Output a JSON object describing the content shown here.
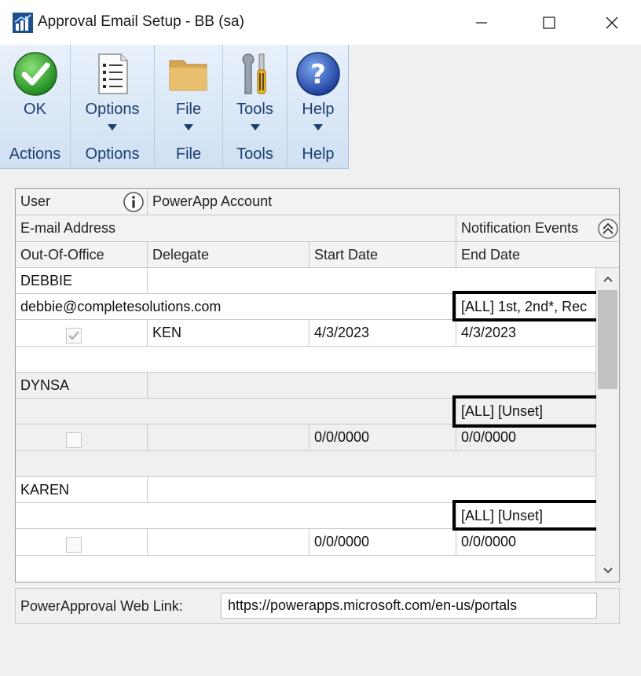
{
  "window": {
    "title": "Approval Email Setup  -  BB (sa)",
    "minimize_icon": "minimize-icon",
    "maximize_icon": "maximize-icon",
    "close_icon": "close-icon"
  },
  "ribbon": {
    "groups": [
      {
        "button_label": "OK",
        "group_label": "Actions",
        "icon": "green-check-icon",
        "has_dropdown": false
      },
      {
        "button_label": "Options",
        "group_label": "Options",
        "icon": "document-list-icon",
        "has_dropdown": true
      },
      {
        "button_label": "File",
        "group_label": "File",
        "icon": "folder-icon",
        "has_dropdown": true
      },
      {
        "button_label": "Tools",
        "group_label": "Tools",
        "icon": "wrench-screwdriver-icon",
        "has_dropdown": true
      },
      {
        "button_label": "Help",
        "group_label": "Help",
        "icon": "help-icon",
        "has_dropdown": true
      }
    ]
  },
  "grid": {
    "headers": {
      "user": "User",
      "powerapp_account": "PowerApp Account",
      "email_address": "E-mail Address",
      "notification_events": "Notification Events",
      "out_of_office": "Out-Of-Office",
      "delegate": "Delegate",
      "start_date": "Start Date",
      "end_date": "End Date"
    },
    "records": [
      {
        "user": "DEBBIE",
        "powerapp_account": "",
        "email": "debbie@completesolutions.com",
        "notification_events": "[ALL] 1st, 2nd*, Rec",
        "out_of_office": true,
        "delegate": "KEN",
        "start_date": "4/3/2023",
        "end_date": "4/3/2023"
      },
      {
        "user": "DYNSA",
        "powerapp_account": "",
        "email": "",
        "notification_events": "[ALL] [Unset]",
        "out_of_office": false,
        "delegate": "",
        "start_date": "0/0/0000",
        "end_date": "0/0/0000"
      },
      {
        "user": "KAREN",
        "powerapp_account": "",
        "email": "",
        "notification_events": "[ALL] [Unset]",
        "out_of_office": false,
        "delegate": "",
        "start_date": "0/0/0000",
        "end_date": "0/0/0000"
      }
    ]
  },
  "web_link": {
    "label": "PowerApproval Web Link:",
    "value": "https://powerapps.microsoft.com/en-us/portals"
  },
  "colors": {
    "ribbon_text": "#1a3f6e",
    "highlight_border": "#000000"
  }
}
